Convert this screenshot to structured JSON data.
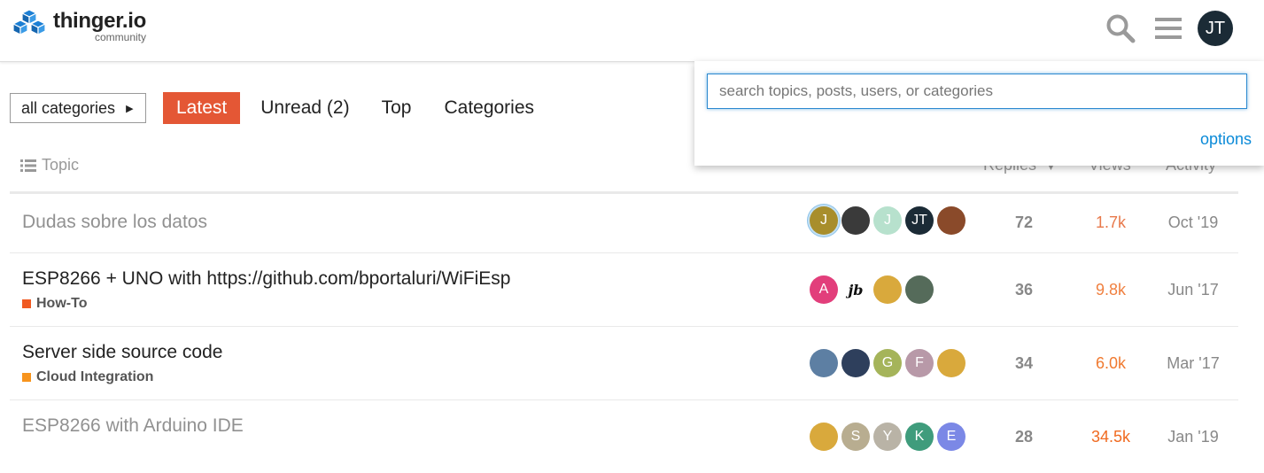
{
  "header": {
    "logo_title": "thinger.io",
    "logo_subtitle": "community",
    "search_icon": "search-icon",
    "menu_icon": "hamburger-menu-icon",
    "user_initials": "JT"
  },
  "nav": {
    "category_dropdown": "all categories",
    "items": [
      {
        "label": "Latest",
        "active": true
      },
      {
        "label": "Unread (2)",
        "active": false
      },
      {
        "label": "Top",
        "active": false
      },
      {
        "label": "Categories",
        "active": false
      }
    ]
  },
  "table": {
    "columns": {
      "topic": "Topic",
      "replies": "Replies",
      "views": "Views",
      "activity": "Activity"
    },
    "rows": [
      {
        "title": "Dudas sobre los datos",
        "visited": true,
        "category": "",
        "category_color": "",
        "posters": [
          {
            "initial": "J",
            "color": "#a88e2c",
            "op": true
          },
          {
            "initial": "",
            "color": "#3a3a3a"
          },
          {
            "initial": "J",
            "color": "#b7e1cd"
          },
          {
            "initial": "JT",
            "color": "#1b2b36"
          },
          {
            "initial": "",
            "color": "#8a4a2a"
          }
        ],
        "replies": "72",
        "views": "1.7k",
        "views_color": "#e8794b",
        "activity": "Oct '19"
      },
      {
        "title": "ESP8266 + UNO with https://github.com/bportaluri/WiFiEsp",
        "visited": false,
        "category": "How-To",
        "category_color": "#f05a22",
        "posters": [
          {
            "initial": "A",
            "color": "#e23e7b"
          },
          {
            "initial": "jb",
            "color": "#ffffff",
            "text": "#111"
          },
          {
            "initial": "",
            "color": "#d9a93c"
          },
          {
            "initial": "",
            "color": "#556b5a"
          }
        ],
        "replies": "36",
        "views": "9.8k",
        "views_color": "#f08040",
        "activity": "Jun '17"
      },
      {
        "title": "Server side source code",
        "visited": false,
        "category": "Cloud Integration",
        "category_color": "#f7941d",
        "posters": [
          {
            "initial": "",
            "color": "#5d7fa3"
          },
          {
            "initial": "",
            "color": "#2e3f5c"
          },
          {
            "initial": "G",
            "color": "#a5b45a"
          },
          {
            "initial": "F",
            "color": "#b899a8"
          },
          {
            "initial": "",
            "color": "#d9a93c"
          }
        ],
        "replies": "34",
        "views": "6.0k",
        "views_color": "#f07a30",
        "activity": "Mar '17"
      },
      {
        "title": "ESP8266 with Arduino IDE",
        "visited": true,
        "category": "",
        "category_color": "",
        "posters": [
          {
            "initial": "",
            "color": "#d9a93c"
          },
          {
            "initial": "S",
            "color": "#b8ad90"
          },
          {
            "initial": "Y",
            "color": "#b9b3a6"
          },
          {
            "initial": "K",
            "color": "#3f9c7c"
          },
          {
            "initial": "E",
            "color": "#7b88e6"
          }
        ],
        "replies": "28",
        "views": "34.5k",
        "views_color": "#f06a20",
        "activity": "Jan '19"
      }
    ]
  },
  "search": {
    "placeholder": "search topics, posts, users, or categories",
    "value": "",
    "options_label": "options"
  }
}
